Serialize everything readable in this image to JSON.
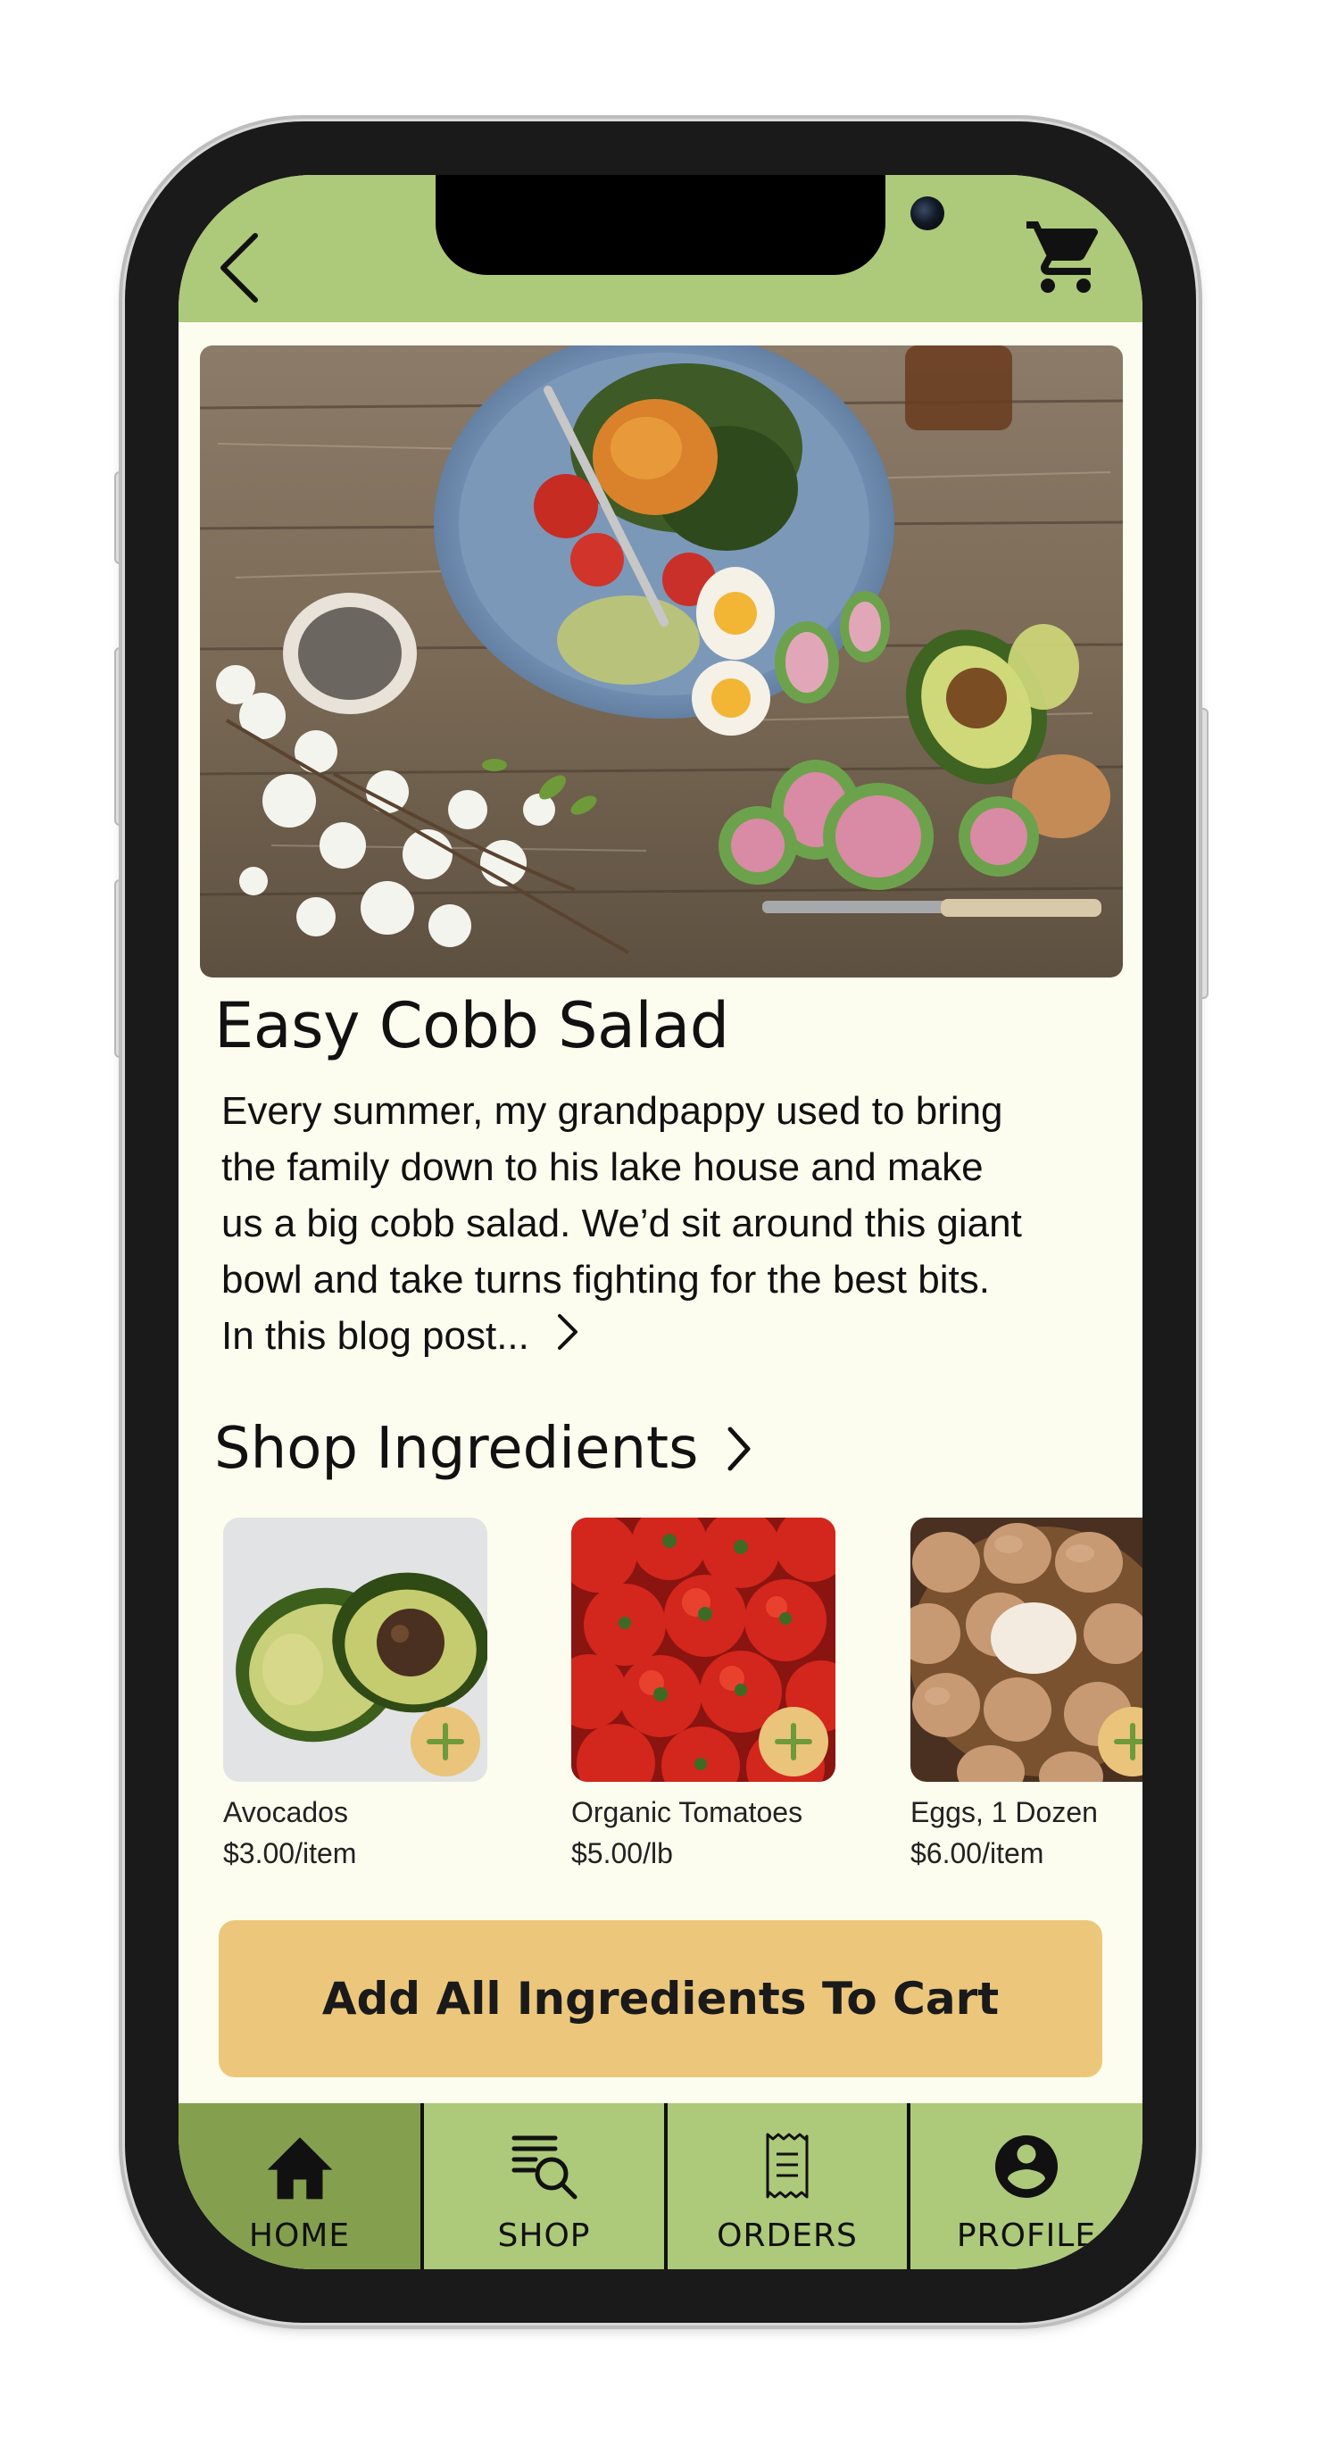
{
  "header": {
    "back_icon": "chevron-left-icon",
    "cart_icon": "shopping-cart-icon"
  },
  "recipe": {
    "title": "Easy Cobb Salad",
    "description_lines": [
      "Every summer, my grandpappy used to bring",
      "the family down to his lake house and make",
      "us a big cobb salad. We’d sit around this giant",
      "bowl and take turns fighting for the best bits.",
      "In this blog post..."
    ]
  },
  "shop": {
    "title": "Shop Ingredients",
    "products": [
      {
        "name": "Avocados",
        "price": "$3.00/item"
      },
      {
        "name": "Organic Tomatoes",
        "price": "$5.00/lb"
      },
      {
        "name": "Eggs, 1 Dozen",
        "price": "$6.00/item"
      }
    ],
    "add_all_label": "Add All Ingredients To Cart"
  },
  "tabbar": {
    "tabs": [
      {
        "label": "HOME",
        "icon": "home-icon",
        "active": true
      },
      {
        "label": "SHOP",
        "icon": "search-list-icon",
        "active": false
      },
      {
        "label": "ORDERS",
        "icon": "receipt-icon",
        "active": false
      },
      {
        "label": "PROFILE",
        "icon": "profile-icon",
        "active": false
      }
    ]
  },
  "colors": {
    "header_green": "#adc97a",
    "active_tab_green": "#84a04e",
    "background_cream": "#fcfdef",
    "cta_yellow": "#ecc77b",
    "add_button": "#e9c47a",
    "add_plus": "#6e9a3c"
  }
}
